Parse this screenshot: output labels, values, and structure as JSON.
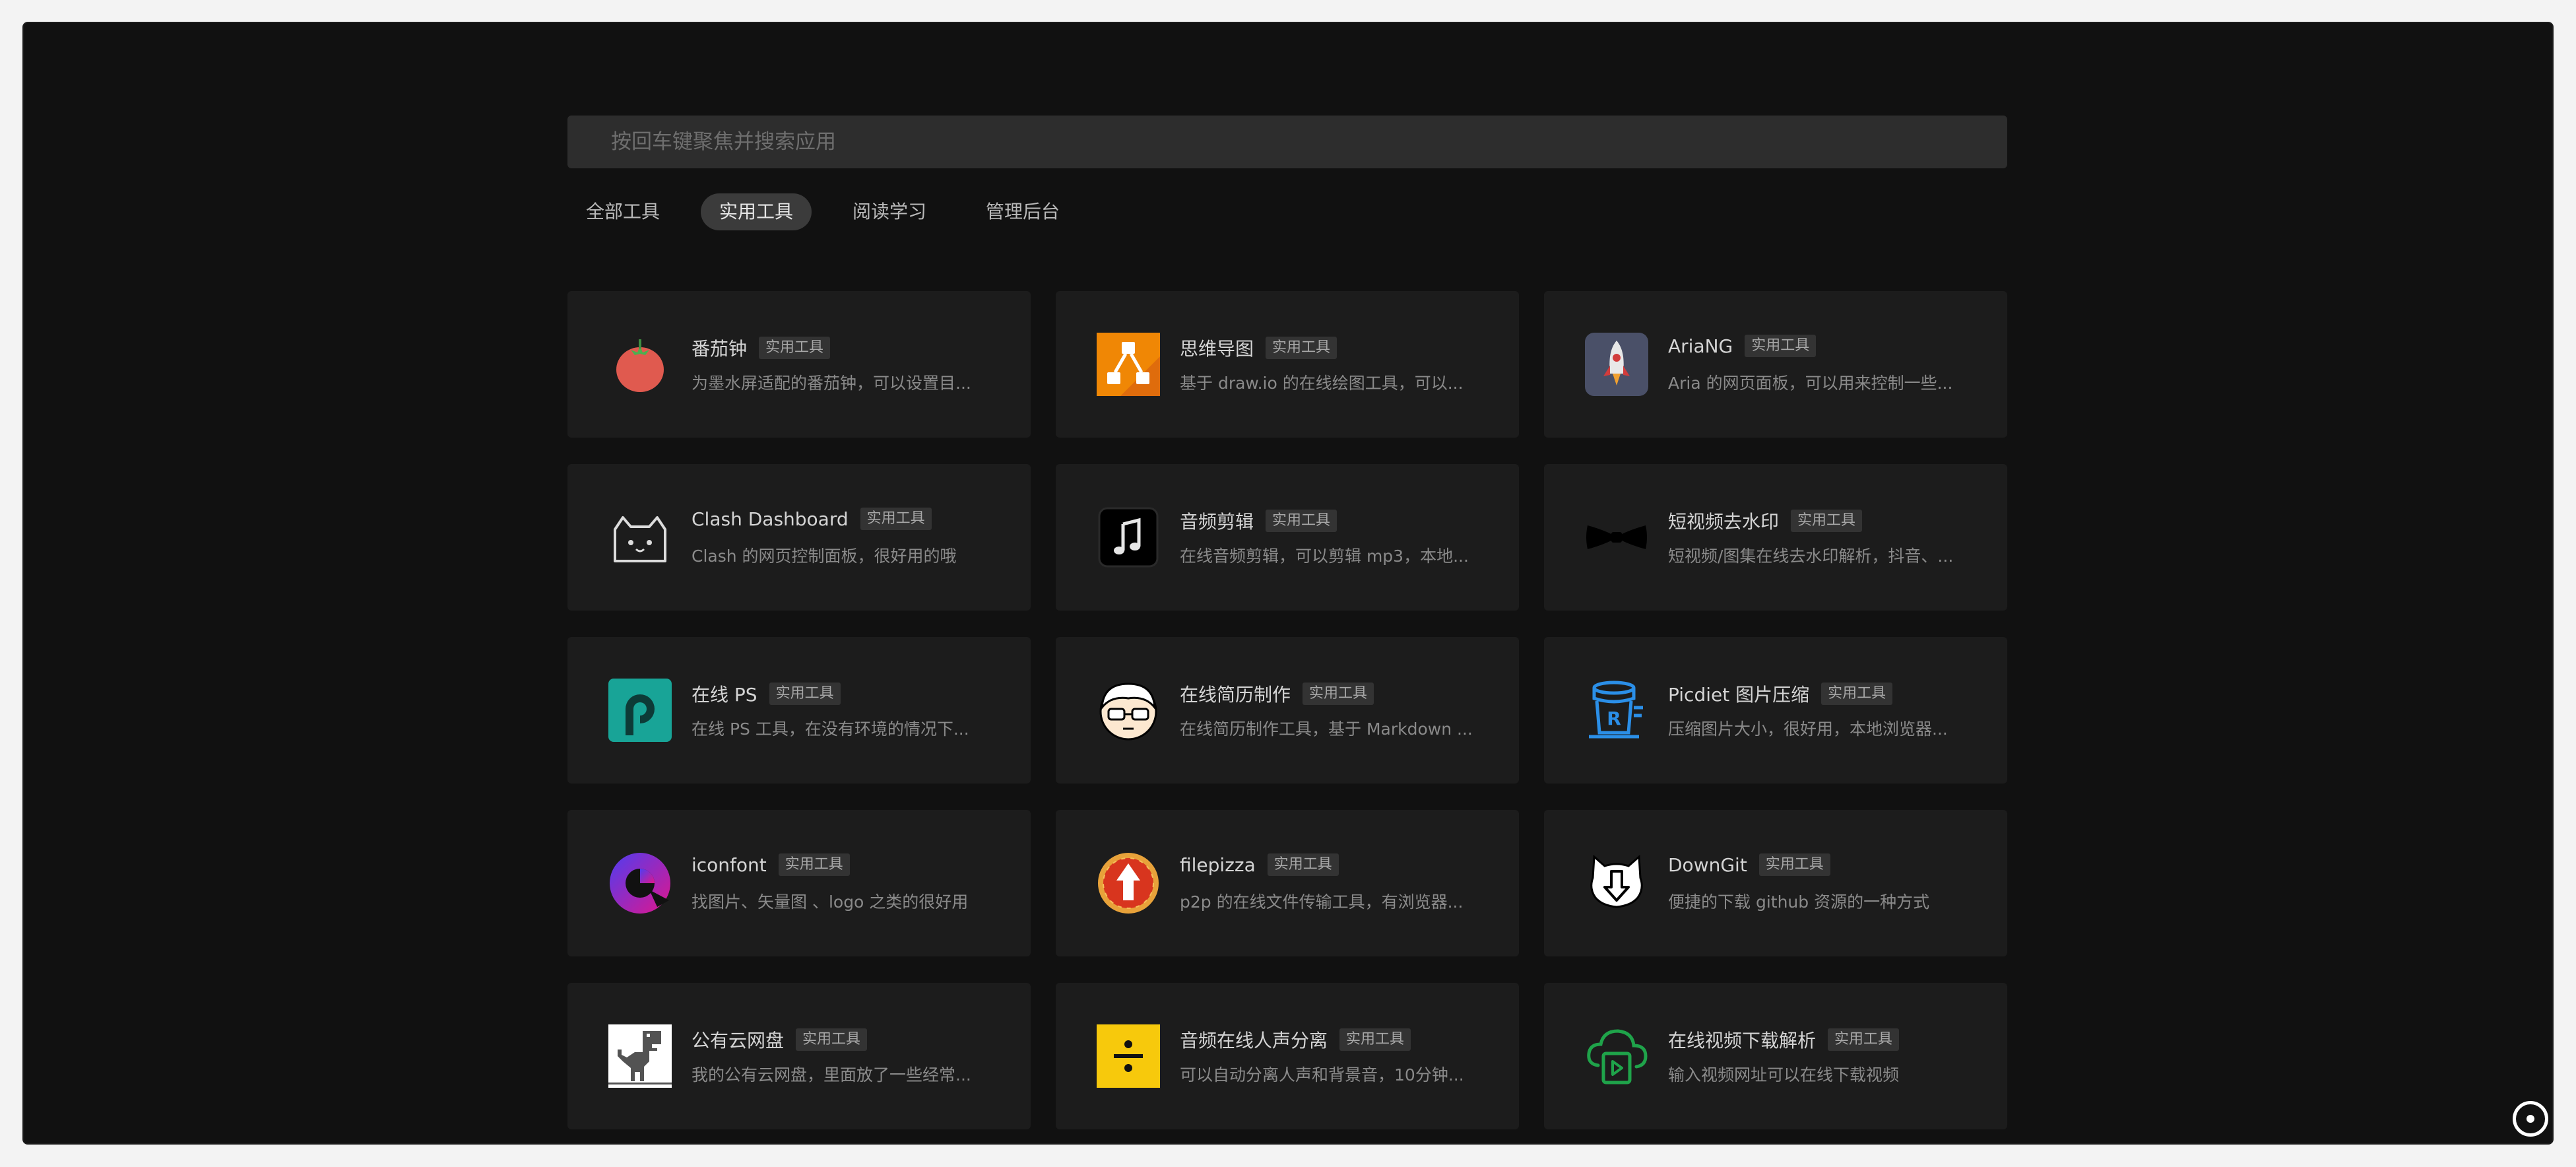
{
  "search": {
    "placeholder": "按回车键聚焦并搜索应用",
    "value": ""
  },
  "tabs": [
    {
      "label": "全部工具",
      "active": false
    },
    {
      "label": "实用工具",
      "active": true
    },
    {
      "label": "阅读学习",
      "active": false
    },
    {
      "label": "管理后台",
      "active": false
    }
  ],
  "cards": [
    {
      "title": "番茄钟",
      "tag": "实用工具",
      "desc": "为墨水屏适配的番茄钟，可以设置目...",
      "icon": "tomato-icon"
    },
    {
      "title": "思维导图",
      "tag": "实用工具",
      "desc": "基于 draw.io 的在线绘图工具，可以...",
      "icon": "drawio-icon"
    },
    {
      "title": "AriaNG",
      "tag": "实用工具",
      "desc": "Aria 的网页面板，可以用来控制一些...",
      "icon": "rocket-icon"
    },
    {
      "title": "Clash Dashboard",
      "tag": "实用工具",
      "desc": "Clash 的网页控制面板，很好用的哦",
      "icon": "cat-icon"
    },
    {
      "title": "音频剪辑",
      "tag": "实用工具",
      "desc": "在线音频剪辑，可以剪辑 mp3，本地...",
      "icon": "music-note-icon"
    },
    {
      "title": "短视频去水印",
      "tag": "实用工具",
      "desc": "短视频/图集在线去水印解析，抖音、...",
      "icon": "bowtie-icon"
    },
    {
      "title": "在线 PS",
      "tag": "实用工具",
      "desc": "在线 PS 工具，在没有环境的情况下...",
      "icon": "photopea-icon"
    },
    {
      "title": "在线简历制作",
      "tag": "实用工具",
      "desc": "在线简历制作工具，基于 Markdown ...",
      "icon": "avatar-glasses-icon"
    },
    {
      "title": "Picdiet 图片压缩",
      "tag": "实用工具",
      "desc": "压缩图片大小，很好用，本地浏览器...",
      "icon": "picdiet-icon"
    },
    {
      "title": "iconfont",
      "tag": "实用工具",
      "desc": "找图片、矢量图 、logo 之类的很好用",
      "icon": "iconfont-icon"
    },
    {
      "title": "filepizza",
      "tag": "实用工具",
      "desc": "p2p 的在线文件传输工具，有浏览器...",
      "icon": "pizza-icon"
    },
    {
      "title": "DownGit",
      "tag": "实用工具",
      "desc": "便捷的下载 github 资源的一种方式",
      "icon": "downgit-icon"
    },
    {
      "title": "公有云网盘",
      "tag": "实用工具",
      "desc": "我的公有云网盘，里面放了一些经常...",
      "icon": "dino-icon"
    },
    {
      "title": "音频在线人声分离",
      "tag": "实用工具",
      "desc": "可以自动分离人声和背景音，10分钟...",
      "icon": "divide-icon"
    },
    {
      "title": "在线视频下载解析",
      "tag": "实用工具",
      "desc": "输入视频网址可以在线下载视频",
      "icon": "cloud-play-icon"
    }
  ],
  "colors": {
    "background": "#111111",
    "card": "#1c1c1c",
    "tag": "#333333",
    "active_tab": "#3b3b3b"
  }
}
